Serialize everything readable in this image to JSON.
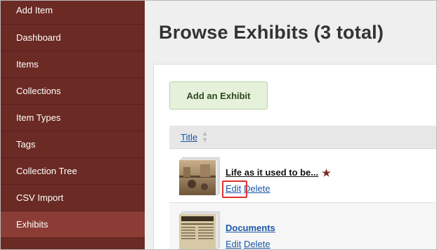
{
  "sidebar": {
    "items": [
      {
        "label": "Add Item"
      },
      {
        "label": "Dashboard"
      },
      {
        "label": "Items"
      },
      {
        "label": "Collections"
      },
      {
        "label": "Item Types"
      },
      {
        "label": "Tags"
      },
      {
        "label": "Collection Tree"
      },
      {
        "label": "CSV Import"
      },
      {
        "label": "Exhibits",
        "active": true
      }
    ]
  },
  "main": {
    "page_title": "Browse Exhibits (3 total)",
    "add_button_label": "Add an Exhibit",
    "table": {
      "column_title": "Title",
      "rows": [
        {
          "title": "Life as it used to be...",
          "featured": true,
          "edit_label": "Edit",
          "delete_label": "Delete"
        },
        {
          "title": "Documents",
          "featured": false,
          "edit_label": "Edit",
          "delete_label": "Delete"
        }
      ]
    }
  },
  "icons": {
    "star": "star-icon",
    "sort": "sort-icon"
  },
  "colors": {
    "sidebar_bg": "#6b2a24",
    "active_bg": "#8b3d35",
    "link": "#1a56a8",
    "highlight": "#e03030",
    "star": "#7a2a22"
  }
}
